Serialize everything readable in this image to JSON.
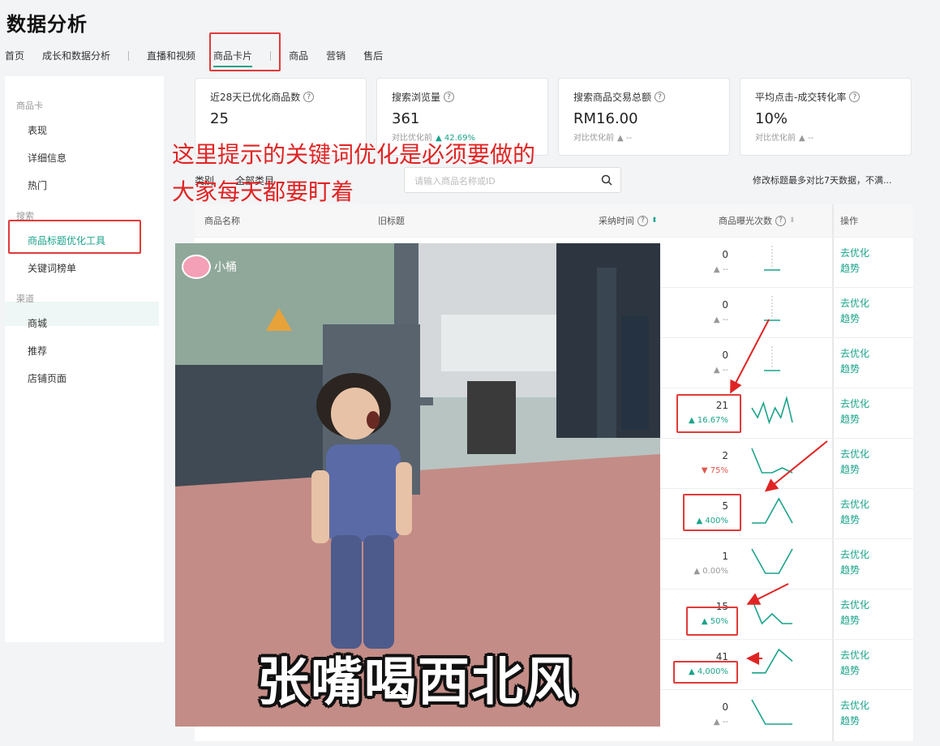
{
  "page_title": "数据分析",
  "nav": {
    "items": [
      "首页",
      "成长和数据分析",
      "直播和视频",
      "商品卡片",
      "商品",
      "营销",
      "售后"
    ],
    "active": "商品卡片"
  },
  "sidebar": {
    "groups": [
      {
        "title": "商品卡",
        "items": [
          "表现",
          "详细信息",
          "热门"
        ]
      },
      {
        "title": "搜索",
        "items": [
          "商品标题优化工具",
          "关键词榜单"
        ]
      },
      {
        "title": "渠道",
        "items": [
          "商城",
          "推荐",
          "店铺页面"
        ]
      }
    ],
    "active": "商品标题优化工具"
  },
  "cards": [
    {
      "label": "近28天已优化商品数",
      "value": "25",
      "compare": "",
      "delta": ""
    },
    {
      "label": "搜索浏览量",
      "value": "361",
      "compare": "对比优化前",
      "delta": "▲ 42.69%"
    },
    {
      "label": "搜索商品交易总额",
      "value": "RM16.00",
      "compare": "对比优化前",
      "delta": "▲ --"
    },
    {
      "label": "平均点击-成交转化率",
      "value": "10%",
      "compare": "对比优化前",
      "delta": "▲ --"
    }
  ],
  "filter": {
    "category_label": "类别",
    "category_value": "全部类目",
    "search_placeholder": "请输入商品名称或ID",
    "note": "修改标题最多对比7天数据，不满..."
  },
  "table": {
    "headers": {
      "name": "商品名称",
      "old_title": "旧标题",
      "time": "采纳时间",
      "exposure": "商品曝光次数",
      "ops": "操作"
    },
    "rows": [
      {
        "value": "0",
        "delta": "▲ --",
        "dir": "flat",
        "trend": [
          0,
          0,
          0,
          0,
          0
        ]
      },
      {
        "value": "0",
        "delta": "▲ --",
        "dir": "flat",
        "trend": [
          0,
          0,
          0,
          0,
          0
        ]
      },
      {
        "value": "0",
        "delta": "▲ --",
        "dir": "flat",
        "trend": [
          0,
          0,
          0,
          0,
          0
        ]
      },
      {
        "value": "21",
        "delta": "▲ 16.67%",
        "dir": "up",
        "trend": [
          4,
          2,
          5,
          1,
          4,
          2,
          6,
          1
        ]
      },
      {
        "value": "2",
        "delta": "▼ 75%",
        "dir": "down",
        "trend": [
          6,
          1,
          1,
          2,
          1
        ]
      },
      {
        "value": "5",
        "delta": "▲ 400%",
        "dir": "up",
        "trend": [
          1,
          1,
          6,
          1
        ]
      },
      {
        "value": "1",
        "delta": "▲ 0.00%",
        "dir": "flat",
        "trend": [
          6,
          1,
          1,
          6
        ]
      },
      {
        "value": "15",
        "delta": "▲ 50%",
        "dir": "up",
        "trend": [
          6,
          1,
          3,
          1,
          1
        ]
      },
      {
        "value": "41",
        "delta": "▲ 4,000%",
        "dir": "up",
        "trend": [
          1,
          1,
          5,
          3
        ]
      },
      {
        "value": "0",
        "delta": "▲ --",
        "dir": "flat",
        "trend": [
          6,
          1,
          1,
          1
        ]
      }
    ],
    "op_optimize": "去优化",
    "op_trend": "趋势"
  },
  "annotation": {
    "line1": "这里提示的关键词优化是必须要做的",
    "line2": "大家每天都要盯着"
  },
  "meme": {
    "caption": "张嘴喝西北风",
    "logo_text": "小桶"
  },
  "colors": {
    "accent": "#1aa38a",
    "annotation": "#e02424",
    "down": "#e0564c"
  }
}
